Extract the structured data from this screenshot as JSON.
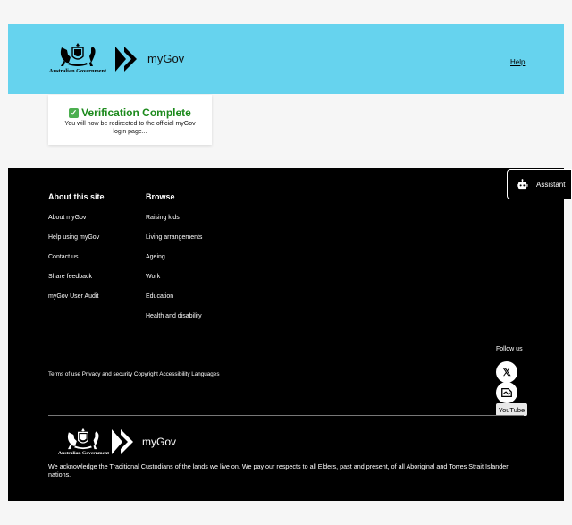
{
  "header": {
    "gov_text": "Australian Government",
    "brand": "myGov",
    "help_label": "Help",
    "bg_color": "#66d3ee"
  },
  "verification": {
    "title": "Verification Complete",
    "message": "You will now be redirected to the official myGov login page...",
    "title_color": "#1c8a1c"
  },
  "footer": {
    "about": {
      "title": "About this site",
      "links": [
        "About myGov",
        "Help using myGov",
        "Contact us",
        "Share feedback",
        "myGov User Audit"
      ]
    },
    "browse": {
      "title": "Browse",
      "links": [
        "Raising kids",
        "Living arrangements",
        "Ageing",
        "Work",
        "Education",
        "Health and disability"
      ]
    },
    "follow_label": "Follow us",
    "youtube_label": "YouTube",
    "legal_links": [
      "Terms of use",
      "Privacy and security",
      "Copyright",
      "Accessibility",
      "Languages"
    ],
    "gov_text": "Australian Government",
    "brand": "myGov",
    "acknowledgement": "We acknowledge the Traditional Custodians of the lands we live on. We pay our respects to all Elders, past and present, of all Aboriginal and Torres Strait Islander nations."
  },
  "assistant": {
    "label": "Assistant",
    "icon": "bot-icon"
  }
}
